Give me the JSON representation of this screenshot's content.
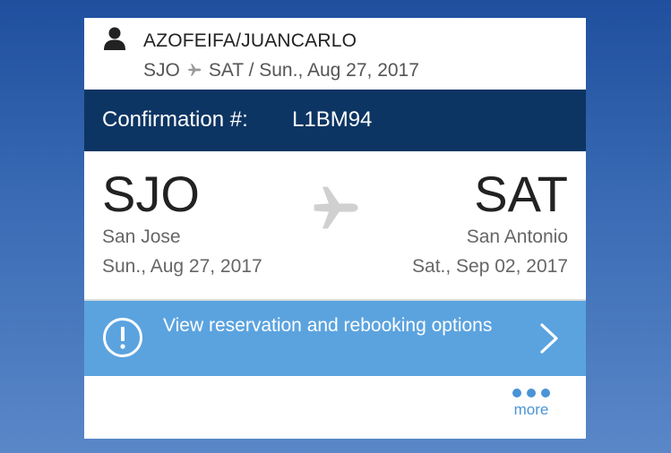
{
  "passenger": {
    "name": "AZOFEIFA/JUANCARLO",
    "route_origin": "SJO",
    "route_rest": "SAT / Sun., Aug 27, 2017"
  },
  "confirmation": {
    "label": "Confirmation #:",
    "code": "L1BM94"
  },
  "flight": {
    "origin": {
      "code": "SJO",
      "city": "San Jose",
      "date": "Sun., Aug 27, 2017"
    },
    "destination": {
      "code": "SAT",
      "city": "San Antonio",
      "date": "Sat., Sep 02, 2017"
    }
  },
  "rebook": {
    "text": "View reservation and rebooking options"
  },
  "more": {
    "label": "more"
  },
  "icons": {
    "person": "person-icon",
    "plane": "plane-icon",
    "alert": "alert-circle-icon",
    "chevron": "chevron-right-icon",
    "more": "more-dots-icon"
  },
  "colors": {
    "confirm_bar": "#0d3563",
    "rebook_bar": "#5ba3df",
    "link": "#4a94d6"
  }
}
